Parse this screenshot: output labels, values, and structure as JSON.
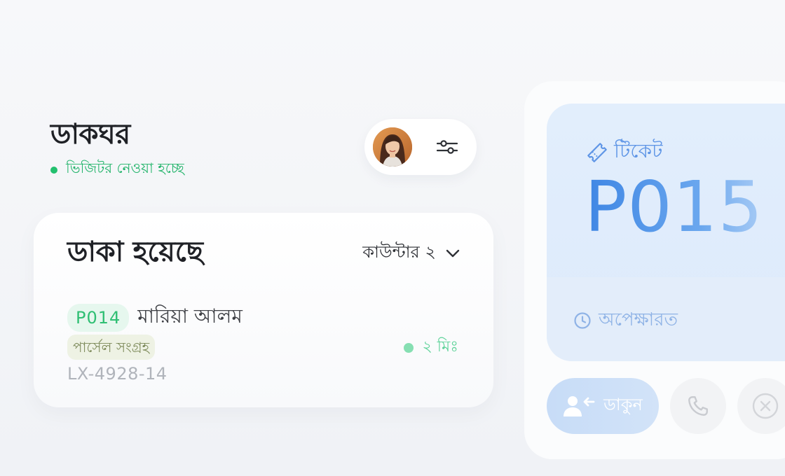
{
  "header": {
    "title": "ডাকঘর",
    "status": "ভিজিটর নেওয়া হচ্ছে"
  },
  "called": {
    "title": "ডাকা হয়েছে",
    "counter": "কাউন্টার ২",
    "entry": {
      "ticket": "P014",
      "name": "মারিয়া আলম",
      "service": "পার্সেল সংগ্রহ",
      "code": "LX-4928-14",
      "wait": "২ মিঃ"
    }
  },
  "current": {
    "label": "টিকেট",
    "number": "P015",
    "status": "অপেক্ষারত"
  },
  "actions": {
    "call_label": "ডাকুন"
  },
  "colors": {
    "accent_blue": "#4a90e6",
    "success_green": "#22c06e",
    "background": "#f3f5f8"
  },
  "icons": {
    "filter": "sliders-icon",
    "ticket": "ticket-icon",
    "clock": "clock-icon",
    "call": "user-call-icon",
    "phone": "phone-icon",
    "cancel": "cancel-icon"
  }
}
